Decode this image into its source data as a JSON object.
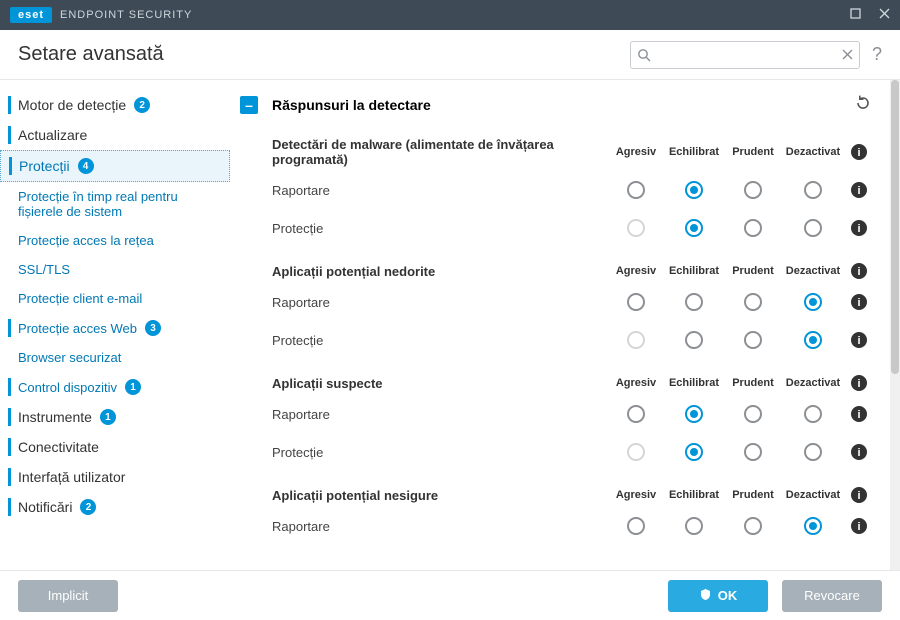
{
  "titlebar": {
    "brand": "eset",
    "product": "ENDPOINT SECURITY"
  },
  "topbar": {
    "title": "Setare avansată",
    "search_placeholder": ""
  },
  "sidebar": [
    {
      "label": "Motor de detecție",
      "type": "top",
      "badge": "2"
    },
    {
      "label": "Actualizare",
      "type": "top-plain"
    },
    {
      "label": "Protecții",
      "type": "top",
      "badge": "4",
      "active": true
    },
    {
      "label": "Protecție în timp real pentru fișierele de sistem",
      "type": "sub"
    },
    {
      "label": "Protecție acces la rețea",
      "type": "sub"
    },
    {
      "label": "SSL/TLS",
      "type": "sub"
    },
    {
      "label": "Protecție client e-mail",
      "type": "sub"
    },
    {
      "label": "Protecție acces Web",
      "type": "sub",
      "badge": "3",
      "marked": true
    },
    {
      "label": "Browser securizat",
      "type": "sub"
    },
    {
      "label": "Control dispozitiv",
      "type": "sub",
      "badge": "1",
      "marked": true
    },
    {
      "label": "Instrumente",
      "type": "top",
      "badge": "1"
    },
    {
      "label": "Conectivitate",
      "type": "top-plain"
    },
    {
      "label": "Interfață utilizator",
      "type": "top-plain"
    },
    {
      "label": "Notificări",
      "type": "top",
      "badge": "2"
    }
  ],
  "section": {
    "title": "Răspunsuri la detectare",
    "columns": [
      "Agresiv",
      "Echilibrat",
      "Prudent",
      "Dezactivat"
    ],
    "groups": [
      {
        "title": "Detectări de malware (alimentate de învățarea programată)",
        "rows": [
          {
            "label": "Raportare",
            "selected": 1,
            "disabled": []
          },
          {
            "label": "Protecție",
            "selected": 1,
            "disabled": [
              0
            ]
          }
        ]
      },
      {
        "title": "Aplicații potențial nedorite",
        "rows": [
          {
            "label": "Raportare",
            "selected": 3,
            "disabled": []
          },
          {
            "label": "Protecție",
            "selected": 3,
            "disabled": [
              0
            ]
          }
        ]
      },
      {
        "title": "Aplicații suspecte",
        "rows": [
          {
            "label": "Raportare",
            "selected": 1,
            "disabled": []
          },
          {
            "label": "Protecție",
            "selected": 1,
            "disabled": [
              0
            ]
          }
        ]
      },
      {
        "title": "Aplicații potențial nesigure",
        "rows": [
          {
            "label": "Raportare",
            "selected": 3,
            "disabled": []
          }
        ]
      }
    ]
  },
  "footer": {
    "default": "Implicit",
    "ok": "OK",
    "cancel": "Revocare"
  },
  "colors": {
    "accent": "#0094d8",
    "header": "#3e4a56"
  }
}
